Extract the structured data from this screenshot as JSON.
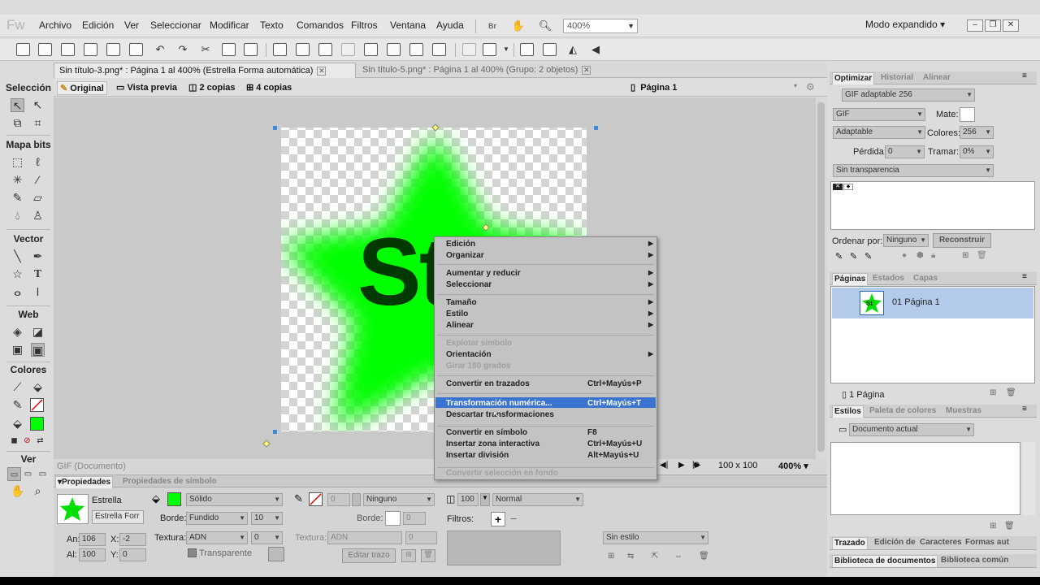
{
  "app": {
    "logo": "Fw",
    "mode": "Modo expandido",
    "zoom": "400%"
  },
  "menu": [
    "Archivo",
    "Edición",
    "Ver",
    "Seleccionar",
    "Modificar",
    "Texto",
    "Comandos",
    "Filtros",
    "Ventana",
    "Ayuda"
  ],
  "doc_tabs": [
    {
      "label": "Sin título-3.png* : Página 1 al 400% (Estrella Forma automática)",
      "active": true
    },
    {
      "label": "Sin título-5.png* : Página 1 al 400% (Grupo: 2 objetos)",
      "active": false
    }
  ],
  "view_tabs": [
    "Original",
    "Vista previa",
    "2 copias",
    "4 copias"
  ],
  "page_selector": "Página 1",
  "tools": {
    "sections": [
      "Selección",
      "Mapa bits",
      "Vector",
      "Web",
      "Colores",
      "Ver"
    ]
  },
  "canvas": {
    "text": "St"
  },
  "status": {
    "format": "GIF (Documento)",
    "size": "100 x 100",
    "zoom": "400%"
  },
  "properties": {
    "tabs": [
      "Propiedades",
      "Propiedades de símbolo"
    ],
    "object_name": "Estrella",
    "object_field": "Estrella Forr",
    "fill_type": "Sólido",
    "edge_label": "Borde:",
    "edge": "Fundido",
    "edge_value": "10",
    "texture_label": "Textura:",
    "texture": "ADN",
    "texture_value": "0",
    "transparent": "Transparente",
    "stroke_width": "0",
    "stroke_type": "Ninguno",
    "stroke_edge_label": "Borde:",
    "stroke_edge_value": "0",
    "stroke_texture_label": "Textura:",
    "stroke_texture": "ADN",
    "stroke_texture_value": "0",
    "edit_stroke": "Editar trazo",
    "opacity": "100",
    "blend": "Normal",
    "filters_label": "Filtros:",
    "style": "Sin estilo",
    "w_label": "An:",
    "w": "106",
    "h_label": "Al:",
    "h": "100",
    "x_label": "X:",
    "x": "-2",
    "y_label": "Y:",
    "y": "0"
  },
  "optimize": {
    "tabs": [
      "Optimizar",
      "Historial",
      "Alinear"
    ],
    "preset": "GIF adaptable 256",
    "format": "GIF",
    "matte_label": "Mate:",
    "palette": "Adaptable",
    "colors_label": "Colores:",
    "colors": "256",
    "loss_label": "Pérdida:",
    "loss": "0",
    "dither_label": "Tramar:",
    "dither": "0%",
    "transparency": "Sin transparencia",
    "sort_label": "Ordenar por:",
    "sort": "Ninguno",
    "rebuild": "Reconstruir"
  },
  "pages": {
    "tabs": [
      "Páginas",
      "Estados",
      "Capas"
    ],
    "item": "01  Página 1",
    "footer": "1 Página",
    "thumb_text": "St"
  },
  "styles": {
    "tabs": [
      "Estilos",
      "Paleta de colores",
      "Muestras"
    ],
    "source": "Documento actual"
  },
  "bottom_tabs": [
    "Trazado",
    "Edición de",
    "Caracteres",
    "Formas aut"
  ],
  "library_tabs": [
    "Biblioteca de documentos",
    "Biblioteca común"
  ],
  "context_menu": {
    "items": [
      {
        "label": "Edición",
        "shortcut": "",
        "submenu": true,
        "disabled": false
      },
      {
        "label": "Organizar",
        "shortcut": "",
        "submenu": true,
        "disabled": false
      },
      {
        "label": "Aumentar y reducir",
        "shortcut": "",
        "submenu": true,
        "disabled": false
      },
      {
        "label": "Seleccionar",
        "shortcut": "",
        "submenu": true,
        "disabled": false
      },
      {
        "label": "Tamaño",
        "shortcut": "",
        "submenu": true,
        "disabled": false
      },
      {
        "label": "Estilo",
        "shortcut": "",
        "submenu": true,
        "disabled": false
      },
      {
        "label": "Alinear",
        "shortcut": "",
        "submenu": true,
        "disabled": false
      },
      {
        "label": "Explotar símbolo",
        "shortcut": "",
        "submenu": false,
        "disabled": true
      },
      {
        "label": "Orientación",
        "shortcut": "",
        "submenu": true,
        "disabled": false
      },
      {
        "label": "Girar 180 grados",
        "shortcut": "",
        "submenu": false,
        "disabled": true
      },
      {
        "label": "Convertir en trazados",
        "shortcut": "Ctrl+Mayús+P",
        "submenu": false,
        "disabled": false
      },
      {
        "label": "Transformación numérica...",
        "shortcut": "Ctrl+Mayús+T",
        "submenu": false,
        "disabled": false,
        "highlighted": true
      },
      {
        "label": "Descartar transformaciones",
        "shortcut": "",
        "submenu": false,
        "disabled": false
      },
      {
        "label": "Convertir en símbolo",
        "shortcut": "F8",
        "submenu": false,
        "disabled": false
      },
      {
        "label": "Insertar zona interactiva",
        "shortcut": "Ctrl+Mayús+U",
        "submenu": false,
        "disabled": false
      },
      {
        "label": "Insertar división",
        "shortcut": "Alt+Mayús+U",
        "submenu": false,
        "disabled": false
      },
      {
        "label": "Convertir selección en fondo",
        "shortcut": "",
        "submenu": false,
        "disabled": true
      }
    ]
  },
  "colors": {
    "accent": "#3a73d0",
    "fill": "#00ff00"
  }
}
